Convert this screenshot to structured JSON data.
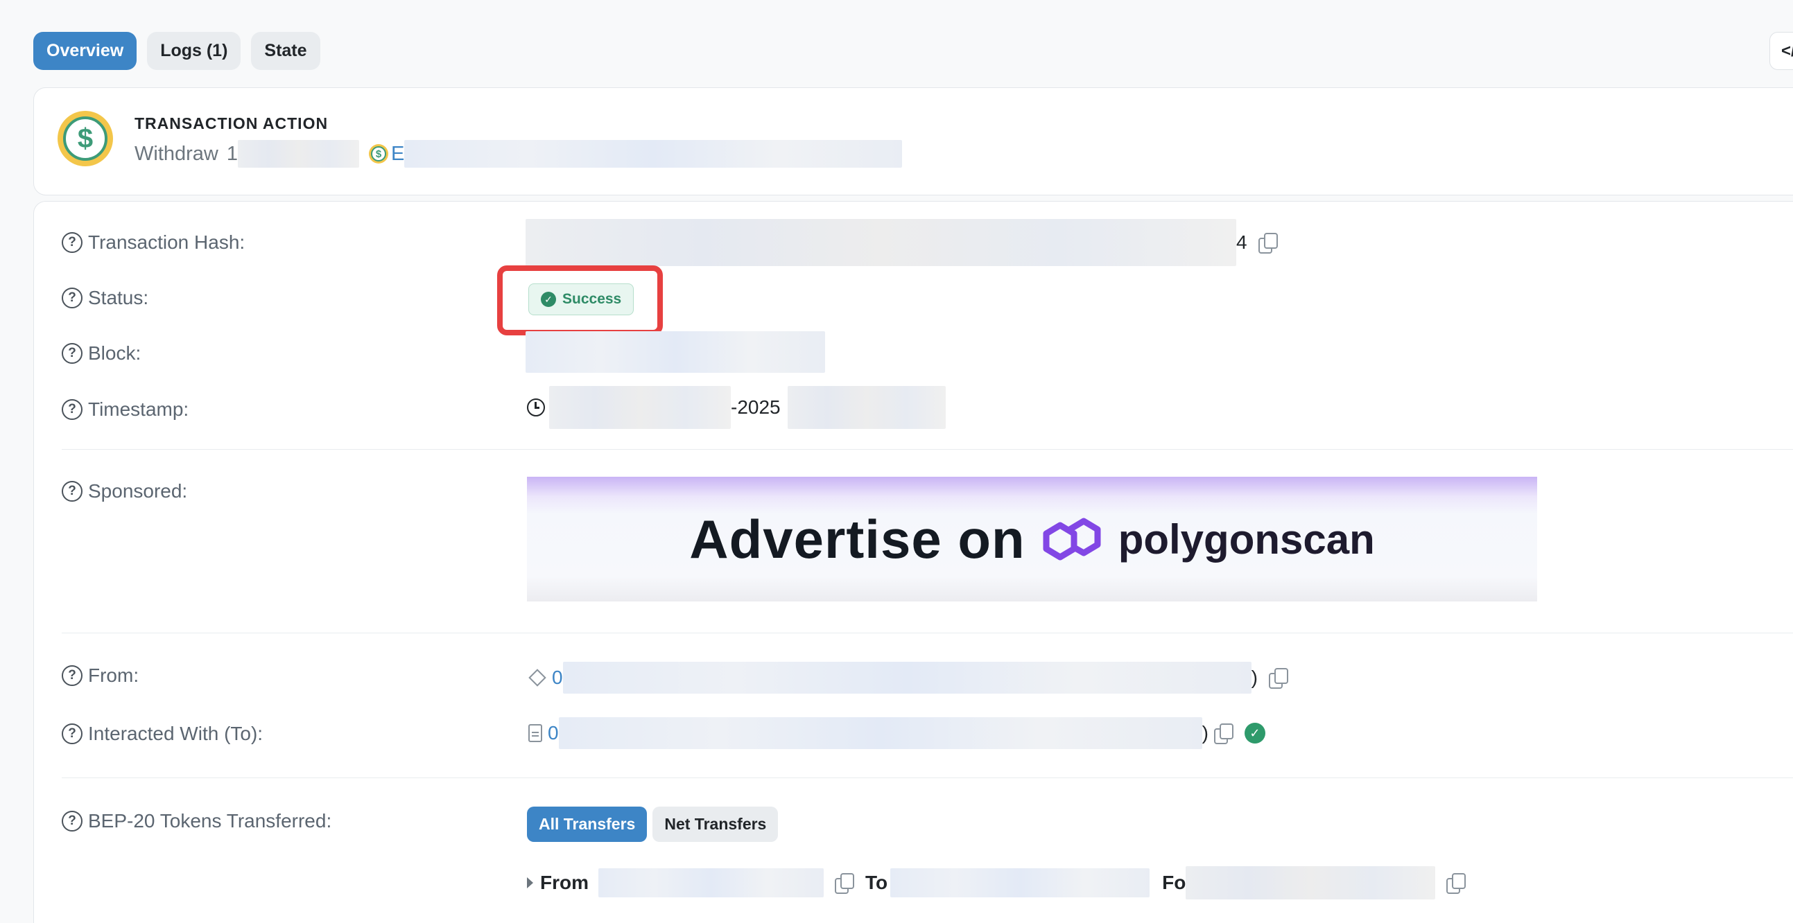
{
  "tabs": [
    {
      "label": "Overview",
      "active": true
    },
    {
      "label": "Logs (1)",
      "active": false
    },
    {
      "label": "State",
      "active": false
    }
  ],
  "corner_button": "</",
  "action": {
    "title": "TRANSACTION ACTION",
    "verb": "Withdraw",
    "amount_prefix": "1",
    "token_prefix": "E"
  },
  "fields": {
    "tx_hash": {
      "label": "Transaction Hash:",
      "value_tail": "4"
    },
    "status": {
      "label": "Status:",
      "value": "Success"
    },
    "block": {
      "label": "Block:"
    },
    "timestamp": {
      "label": "Timestamp:",
      "value_mid": "-2025"
    },
    "sponsored": {
      "label": "Sponsored:",
      "ad_text": "Advertise on",
      "ad_brand": "polygonscan"
    },
    "from": {
      "label": "From:",
      "prefix": "0",
      "suffix": ")"
    },
    "to": {
      "label": "Interacted With (To):",
      "prefix": "0",
      "suffix": ")"
    },
    "tokens": {
      "label": "BEP-20 Tokens Transferred:",
      "buttons": [
        "All Transfers",
        "Net Transfers"
      ],
      "row": {
        "from_label": "From",
        "to_label": "To",
        "for_label": "Fo"
      }
    }
  },
  "colors": {
    "primary": "#3d85c6",
    "success": "#2e8b66",
    "highlight": "#e74040"
  },
  "icons": [
    "dollar-coin-icon",
    "help-icon",
    "copy-icon",
    "check-circle-icon",
    "clock-icon",
    "polygon-logo-icon",
    "document-icon",
    "address-icon"
  ]
}
